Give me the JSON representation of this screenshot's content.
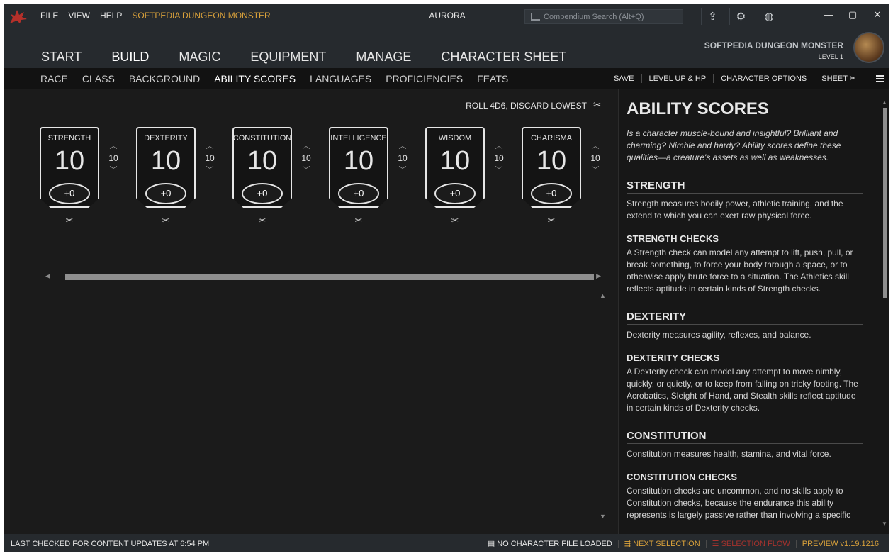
{
  "menu": {
    "file": "FILE",
    "view": "VIEW",
    "help": "HELP",
    "character_name": "SOFTPEDIA DUNGEON MONSTER"
  },
  "app_title": "AURORA",
  "search": {
    "placeholder": "Compendium Search  (Alt+Q)"
  },
  "toolbar_icons": [
    "export-icon",
    "gear-icon",
    "globe-icon"
  ],
  "window_controls": {
    "minimize": "—",
    "maximize": "▢",
    "close": "✕"
  },
  "nav": {
    "tabs": [
      {
        "label": "START"
      },
      {
        "label": "BUILD"
      },
      {
        "label": "MAGIC"
      },
      {
        "label": "EQUIPMENT"
      },
      {
        "label": "MANAGE"
      },
      {
        "label": "CHARACTER SHEET"
      }
    ],
    "active": "BUILD"
  },
  "profile": {
    "name": "SOFTPEDIA DUNGEON MONSTER",
    "level": "LEVEL 1"
  },
  "subnav": {
    "tabs": [
      {
        "label": "RACE"
      },
      {
        "label": "CLASS"
      },
      {
        "label": "BACKGROUND"
      },
      {
        "label": "ABILITY SCORES"
      },
      {
        "label": "LANGUAGES"
      },
      {
        "label": "PROFICIENCIES"
      },
      {
        "label": "FEATS"
      }
    ],
    "active": "ABILITY SCORES",
    "actions": [
      {
        "label": "SAVE"
      },
      {
        "label": "LEVEL UP & HP"
      },
      {
        "label": "CHARACTER OPTIONS"
      },
      {
        "label": "SHEET"
      }
    ]
  },
  "roll": {
    "label": "ROLL 4D6, DISCARD LOWEST"
  },
  "abilities": [
    {
      "name": "STRENGTH",
      "score": "10",
      "modifier": "+0",
      "base": "10"
    },
    {
      "name": "DEXTERITY",
      "score": "10",
      "modifier": "+0",
      "base": "10"
    },
    {
      "name": "CONSTITUTION",
      "score": "10",
      "modifier": "+0",
      "base": "10"
    },
    {
      "name": "INTELLIGENCE",
      "score": "10",
      "modifier": "+0",
      "base": "10"
    },
    {
      "name": "WISDOM",
      "score": "10",
      "modifier": "+0",
      "base": "10"
    },
    {
      "name": "CHARISMA",
      "score": "10",
      "modifier": "+0",
      "base": "10"
    }
  ],
  "panel": {
    "title": "ABILITY SCORES",
    "intro": "Is a character muscle-bound and insightful? Brilliant and charming? Nimble and hardy? Ability scores define these qualities—a creature's assets as well as weaknesses.",
    "sections": [
      {
        "heading": "STRENGTH",
        "text": "Strength measures bodily power, athletic training, and the extend to which you can exert raw physical force.",
        "check_heading": "STRENGTH CHECKS",
        "check_text": "A Strength check can model any attempt to lift, push, pull, or break something, to force your body through a space, or to otherwise apply brute force to a situation. The Athletics skill reflects aptitude in certain kinds of Strength checks."
      },
      {
        "heading": "DEXTERITY",
        "text": "Dexterity measures agility, reflexes, and balance.",
        "check_heading": "DEXTERITY CHECKS",
        "check_text": "A Dexterity check can model any attempt to move nimbly, quickly, or quietly, or to keep from falling on tricky footing. The Acrobatics, Sleight of Hand, and Stealth skills reflect aptitude in certain kinds of Dexterity checks."
      },
      {
        "heading": "CONSTITUTION",
        "text": "Constitution measures health, stamina, and vital force.",
        "check_heading": "CONSTITUTION CHECKS",
        "check_text": "Constitution checks are uncommon, and no skills apply to Constitution checks, because the endurance this ability represents is largely passive rather than involving a specific"
      }
    ]
  },
  "status": {
    "left": "LAST CHECKED FOR CONTENT UPDATES AT 6:54 PM",
    "file": "NO CHARACTER FILE LOADED",
    "next_selection": "NEXT SELECTION",
    "selection_flow": "SELECTION FLOW",
    "version": "PREVIEW v1.19.1216"
  },
  "colors": {
    "accent": "#d9a13b",
    "background": "#1b1b1b",
    "chrome": "#262a2e",
    "flow": "#a6322d"
  }
}
